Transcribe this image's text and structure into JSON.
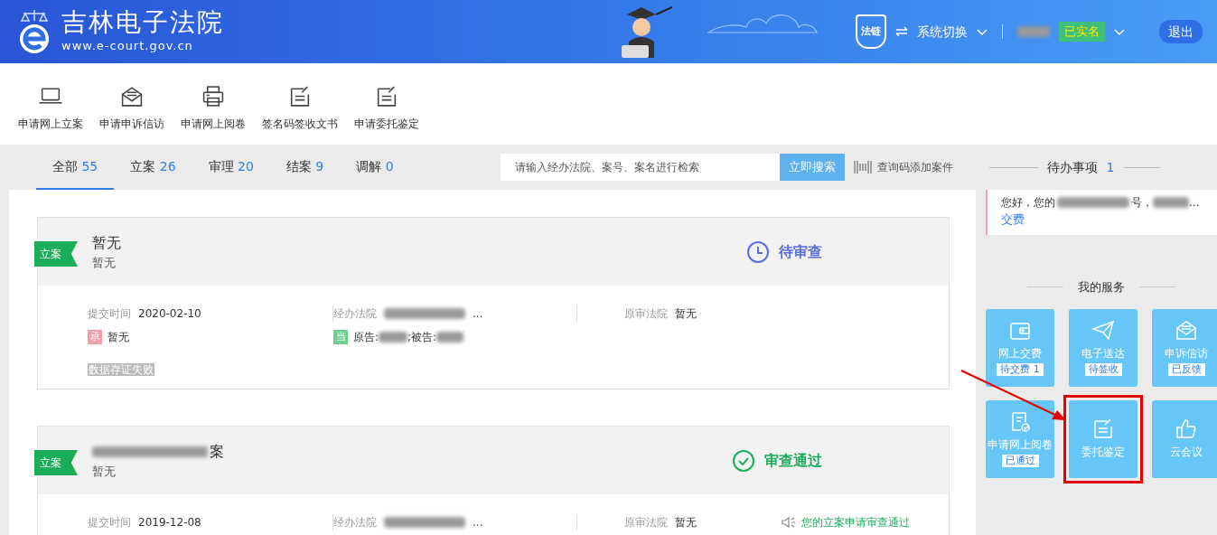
{
  "header": {
    "title": "吉林电子法院",
    "url": "www.e-court.gov.cn",
    "chain_label": "法链",
    "system_switch": "系统切换",
    "verified_badge": "已实名",
    "logout": "退出"
  },
  "toolbar": [
    {
      "label": "申请网上立案",
      "kind": "laptop"
    },
    {
      "label": "申请申诉信访",
      "kind": "mail"
    },
    {
      "label": "申请网上阅卷",
      "kind": "printer"
    },
    {
      "label": "签名码签收文书",
      "kind": "note"
    },
    {
      "label": "申请委托鉴定",
      "kind": "note"
    }
  ],
  "tabs": [
    {
      "label": "全部",
      "count": "55",
      "selected": true
    },
    {
      "label": "立案",
      "count": "26",
      "selected": false
    },
    {
      "label": "审理",
      "count": "20",
      "selected": false
    },
    {
      "label": "结案",
      "count": "9",
      "selected": false
    },
    {
      "label": "调解",
      "count": "0",
      "selected": false
    }
  ],
  "search": {
    "placeholder": "请输入经办法院、案号、案名进行检索",
    "button": "立即搜索",
    "code_link": "查询码添加案件"
  },
  "todo": {
    "label": "待办事项",
    "count": "1",
    "notice_start": "您好，您的",
    "notice_mid": "号，",
    "notice_end": "...",
    "notice_link": "交费"
  },
  "cases": [
    {
      "tag": "立案",
      "title": "暂无",
      "title_redacted": false,
      "subtitle": "暂无",
      "status": "待审查",
      "kind": "pending",
      "submit_label": "提交时间",
      "submit_date": "2020-02-10",
      "court_label": "经办法院",
      "court_value": "...",
      "orig_label": "原审法院",
      "orig_value": "暂无",
      "judge_badge": "承",
      "judge": "暂无",
      "party_badge": "当",
      "plaintiff": "原告:",
      "defendant": ";被告:",
      "evidence_tag": "数据存证失败"
    },
    {
      "tag": "立案",
      "title": "案",
      "title_redacted": true,
      "subtitle": "暂无",
      "status": "审查通过",
      "kind": "passed",
      "submit_label": "提交时间",
      "submit_date": "2019-12-08",
      "court_label": "经办法院",
      "court_value": "...",
      "orig_label": "原审法院",
      "orig_value": "暂无",
      "notice": "您的立案申请审查通过"
    }
  ],
  "services": {
    "title": "我的服务",
    "tiles": [
      {
        "label": "网上交费",
        "badge": "待交费 1",
        "kind": "wallet",
        "highlighted": false
      },
      {
        "label": "电子送达",
        "badge": "待签收",
        "kind": "plane",
        "highlighted": false
      },
      {
        "label": "申诉信访",
        "badge": "已反馈",
        "kind": "mail",
        "highlighted": false
      },
      {
        "label": "申请网上阅卷",
        "badge": "已通过",
        "kind": "review",
        "highlighted": false
      },
      {
        "label": "委托鉴定",
        "kind": "note",
        "highlighted": true
      },
      {
        "label": "云会议",
        "kind": "thumb",
        "highlighted": false
      }
    ]
  }
}
